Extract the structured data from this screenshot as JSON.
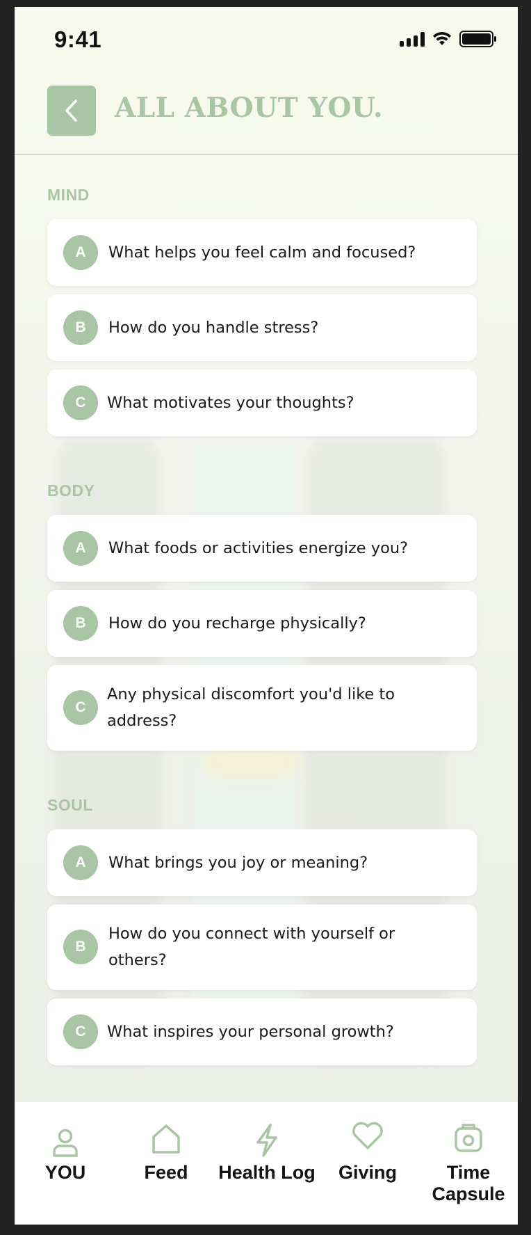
{
  "status_bar": {
    "time": "9:41"
  },
  "header": {
    "title": "ALL ABOUT YOU."
  },
  "sections": [
    {
      "label": "MIND",
      "questions": [
        {
          "badge": "A",
          "text": "What helps you feel calm and focused?"
        },
        {
          "badge": "B",
          "text": "How do you handle stress?"
        },
        {
          "badge": "C",
          "text": "What motivates your thoughts?"
        }
      ]
    },
    {
      "label": "BODY",
      "questions": [
        {
          "badge": "A",
          "text": "What foods or activities energize you?"
        },
        {
          "badge": "B",
          "text": "How do you recharge physically?"
        },
        {
          "badge": "C",
          "text": "Any physical discomfort you'd like to address?"
        }
      ]
    },
    {
      "label": "SOUL",
      "questions": [
        {
          "badge": "A",
          "text": "What brings you joy or meaning?"
        },
        {
          "badge": "B",
          "text": "How do you connect with yourself or others?"
        },
        {
          "badge": "C",
          "text": "What inspires your personal growth?"
        }
      ]
    }
  ],
  "tabbar": {
    "items": [
      {
        "label": "YOU",
        "icon": "user-icon"
      },
      {
        "label": "Feed",
        "icon": "home-icon"
      },
      {
        "label": "Health Log",
        "icon": "lightning-icon"
      },
      {
        "label": "Giving",
        "icon": "heart-icon"
      },
      {
        "label": "Time Capsule",
        "icon": "camera-icon"
      }
    ]
  },
  "colors": {
    "accent": "#a8c6a3",
    "text": "#1a1a1a",
    "card": "#ffffff",
    "frame": "#222222"
  }
}
